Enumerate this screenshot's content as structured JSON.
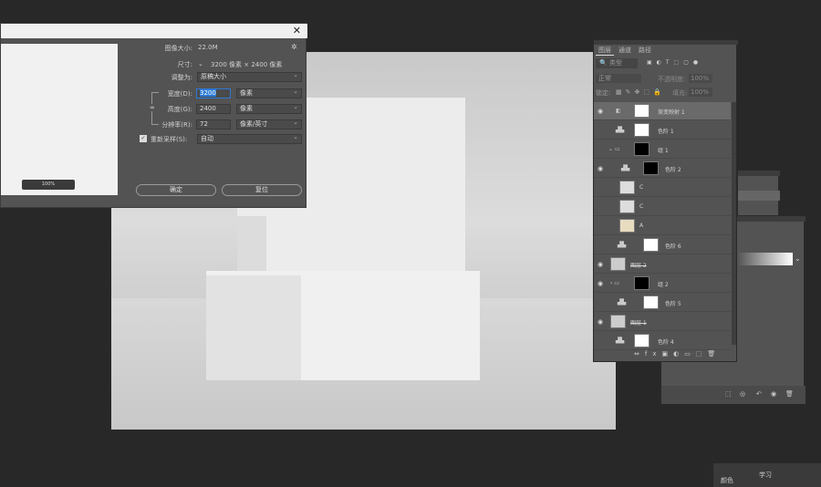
{
  "dialog": {
    "image_size_label": "图像大小:",
    "image_size_value": "22.0M",
    "dims_label": "尺寸:",
    "dims_value": "3200 像素 × 2400 像素",
    "fit_label": "调整为:",
    "fit_value": "原稿大小",
    "width_label": "宽度(D):",
    "width_value": "3200",
    "width_unit": "像素",
    "height_label": "高度(G):",
    "height_value": "2400",
    "height_unit": "像素",
    "res_label": "分辨率(R):",
    "res_value": "72",
    "res_unit": "像素/英寸",
    "resample_label": "重新采样(S):",
    "resample_value": "自动",
    "ok": "确定",
    "reset": "复位",
    "zoom": "100%",
    "close": "✕"
  },
  "layers": {
    "tabs": [
      "图层",
      "通道",
      "路径"
    ],
    "kind": "类型",
    "mode": "正常",
    "opacity_label": "不透明度:",
    "opacity": "100%",
    "lock_label": "锁定:",
    "fill_label": "填充:",
    "fill": "100%",
    "rows": [
      "渐变映射 1",
      "色阶 1",
      "组 1",
      "色阶 2",
      "C",
      "C",
      "A",
      "色阶 6",
      "图层 2",
      "组 2",
      "色阶 5",
      "图层 1",
      "色阶 4"
    ]
  },
  "side": {
    "bottom_a": "颜色",
    "bottom_b": "学习"
  }
}
